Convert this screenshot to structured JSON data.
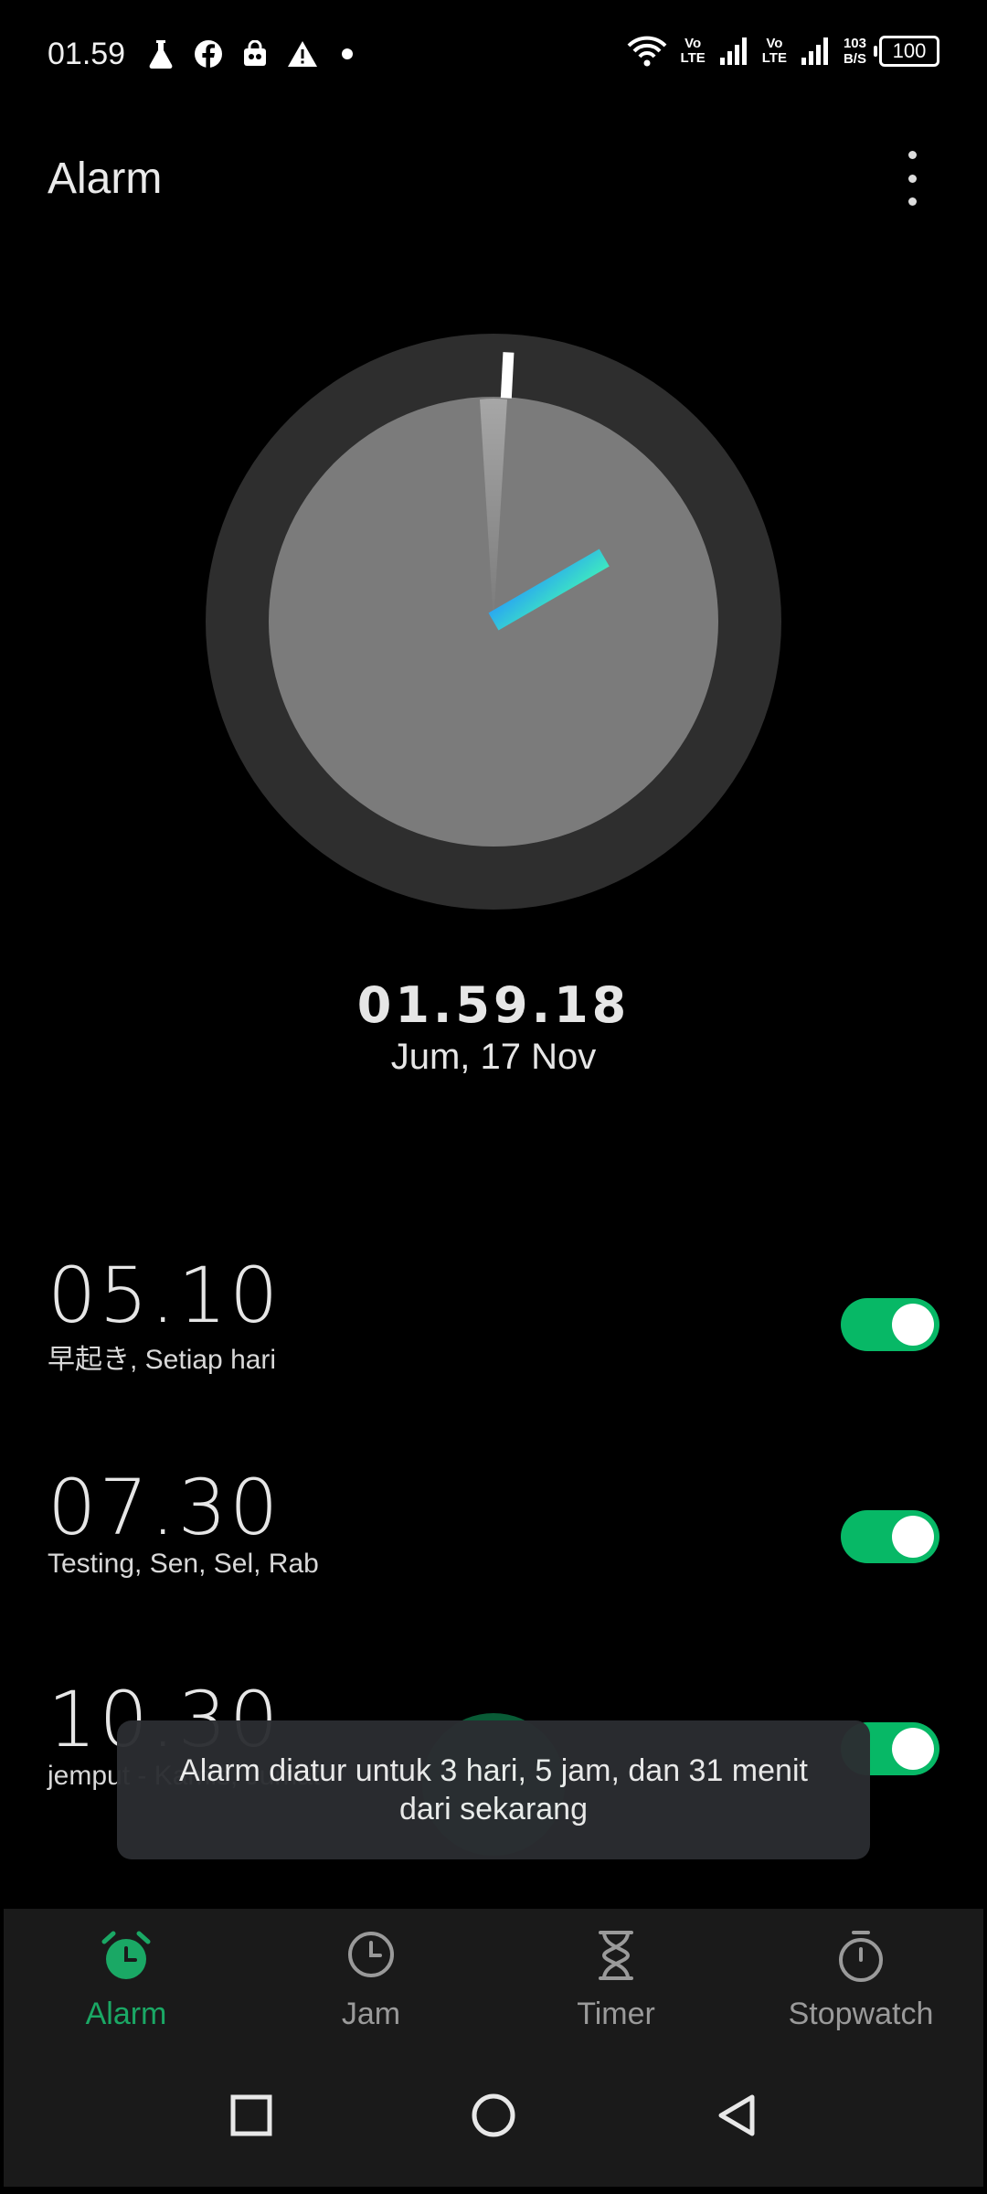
{
  "status_bar": {
    "time": "01.59",
    "volte1_top": "Vo",
    "volte1_bottom": "LTE",
    "volte2_top": "Vo",
    "volte2_bottom": "LTE",
    "net_speed_value": "103",
    "net_speed_unit": "B/S",
    "battery": "100",
    "icons": [
      "lab-flask-icon",
      "facebook-icon",
      "shopping-bag-icon",
      "warning-icon",
      "dot-icon",
      "wifi-icon",
      "signal-icon",
      "signal-icon",
      "battery-icon"
    ]
  },
  "header": {
    "title": "Alarm"
  },
  "clock": {
    "time": "01.59.18",
    "date": "Jum, 17 Nov",
    "hour_hand_angle_deg": 60,
    "second_hand_angle_deg": 3
  },
  "alarms": [
    {
      "time": "05.10",
      "label": "早起き,  Setiap hari",
      "enabled": true
    },
    {
      "time": "07.30",
      "label": "Testing,  Sen, Sel, Rab",
      "enabled": true
    },
    {
      "time": "10.30",
      "label": "jemput - Kamis, Jumat",
      "enabled": true
    }
  ],
  "toast": {
    "message": "Alarm diatur untuk 3 hari, 5 jam, dan 31 menit dari sekarang"
  },
  "bottom_nav": {
    "items": [
      {
        "label": "Alarm",
        "icon": "alarm-clock-icon",
        "active": true
      },
      {
        "label": "Jam",
        "icon": "clock-icon",
        "active": false
      },
      {
        "label": "Timer",
        "icon": "hourglass-icon",
        "active": false
      },
      {
        "label": "Stopwatch",
        "icon": "stopwatch-icon",
        "active": false
      }
    ]
  },
  "system_nav": {
    "icons": [
      "recents-square-icon",
      "home-circle-icon",
      "back-triangle-icon"
    ]
  },
  "colors": {
    "accent": "#1aa865",
    "toggle_on": "#07b866",
    "background": "#000000",
    "clock_ring": "#2e2e2e",
    "clock_face": "#7b7b7b"
  }
}
